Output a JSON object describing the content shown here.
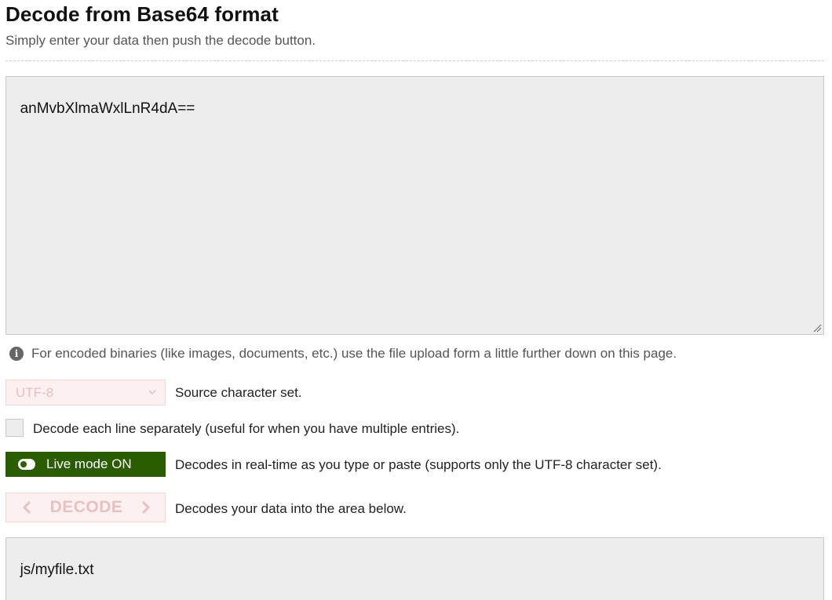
{
  "header": {
    "title": "Decode from Base64 format",
    "subtitle": "Simply enter your data then push the decode button."
  },
  "input": {
    "value": "anMvbXlmaWxlLnR4dA=="
  },
  "info": {
    "icon": "info-icon",
    "text": "For encoded binaries (like images, documents, etc.) use the file upload form a little further down on this page."
  },
  "charset": {
    "selected": "UTF-8",
    "label": "Source character set."
  },
  "line_option": {
    "checked": false,
    "label": "Decode each line separately (useful for when you have multiple entries)."
  },
  "live_mode": {
    "button_label": "Live mode ON",
    "description": "Decodes in real-time as you type or paste (supports only the UTF-8 character set).",
    "color": "#2a5d00"
  },
  "decode": {
    "button_label": "DECODE",
    "description": "Decodes your data into the area below."
  },
  "output": {
    "value": "js/myfile.txt"
  }
}
